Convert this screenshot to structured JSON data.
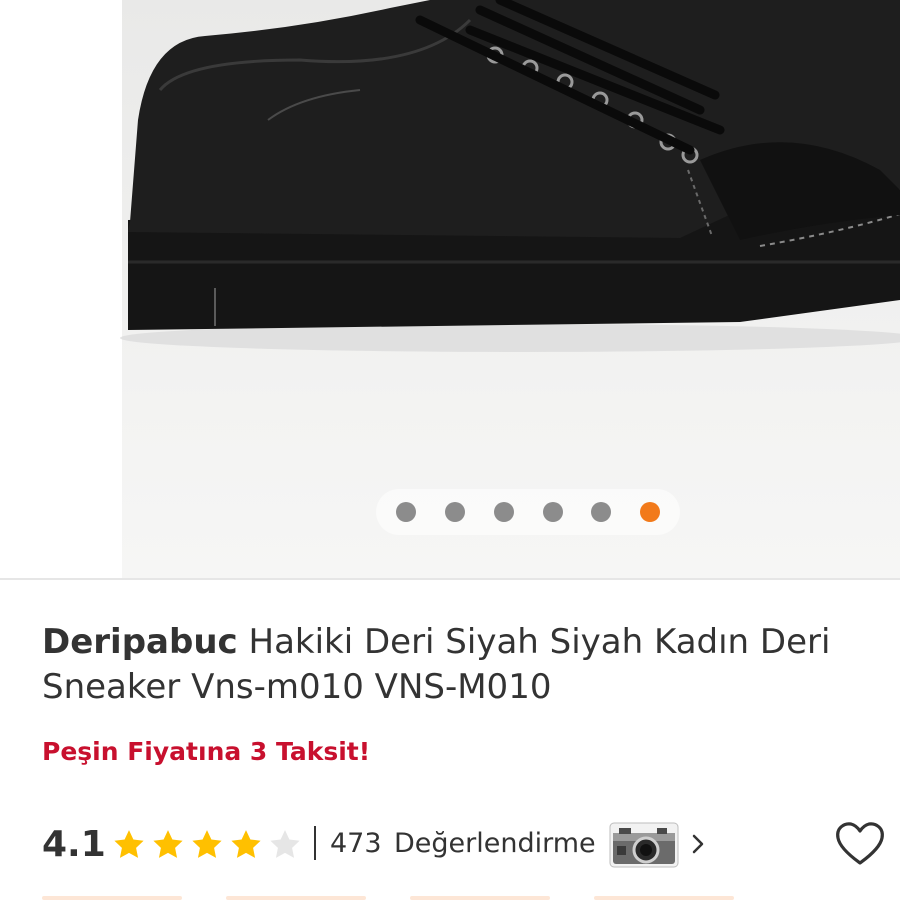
{
  "gallery": {
    "slide_count": 6,
    "active_slide": 6,
    "accent_color": "#f27a1a",
    "inactive_dot_color": "#8c8c8c",
    "image": "black-leather-sneaker-photo"
  },
  "product": {
    "brand": "Deripabuc",
    "name": "Hakiki Deri Siyah Siyah Kadın Deri Sneaker Vns-m010 VNS-M010",
    "promo": "Peşin Fiyatına 3 Taksit!",
    "promo_color": "#c8102e"
  },
  "rating": {
    "score": "4.1",
    "stars_filled": 4,
    "stars_total": 5,
    "star_color": "#ffc000",
    "count": "473",
    "count_label": "Değerlendirme"
  },
  "icons": {
    "photo_reviews": "camera-icon",
    "more": "chevron-right-icon",
    "favorite": "heart-icon"
  }
}
